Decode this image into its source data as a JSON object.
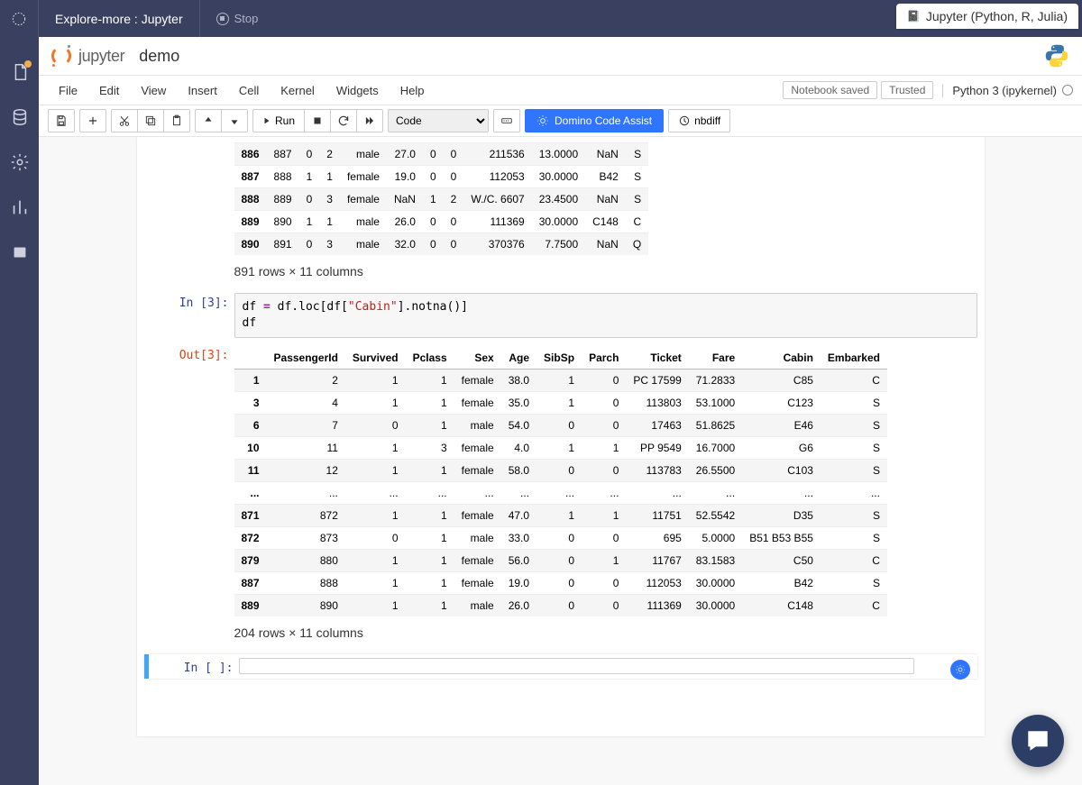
{
  "topbar": {
    "title": "Explore-more : Jupyter",
    "stop_label": "Stop",
    "chip_label": "Jupyter (Python, R, Julia)"
  },
  "header": {
    "logo_word": "jupyter",
    "notebook_name": "demo"
  },
  "menu": {
    "items": [
      "File",
      "Edit",
      "View",
      "Insert",
      "Cell",
      "Kernel",
      "Widgets",
      "Help"
    ],
    "status": "Notebook saved",
    "trusted": "Trusted",
    "kernel": "Python 3 (ipykernel)"
  },
  "toolbar": {
    "run_label": "Run",
    "cell_type": "Code",
    "dca_label": "Domino Code Assist",
    "nbdiff_label": "nbdiff"
  },
  "cells": {
    "in3_label": "In [3]:",
    "out3_label": "Out[3]:",
    "in3_code_plain": "df = df.loc[df[\"Cabin\"].notna()]\ndf",
    "in_empty_label": "In [ ]:"
  },
  "table1": {
    "rows": [
      {
        "idx": "886",
        "PassengerId": "887",
        "Survived": "0",
        "Pclass": "2",
        "Sex": "male",
        "Age": "27.0",
        "SibSp": "0",
        "Parch": "0",
        "Ticket": "211536",
        "Fare": "13.0000",
        "Cabin": "NaN",
        "Embarked": "S"
      },
      {
        "idx": "887",
        "PassengerId": "888",
        "Survived": "1",
        "Pclass": "1",
        "Sex": "female",
        "Age": "19.0",
        "SibSp": "0",
        "Parch": "0",
        "Ticket": "112053",
        "Fare": "30.0000",
        "Cabin": "B42",
        "Embarked": "S"
      },
      {
        "idx": "888",
        "PassengerId": "889",
        "Survived": "0",
        "Pclass": "3",
        "Sex": "female",
        "Age": "NaN",
        "SibSp": "1",
        "Parch": "2",
        "Ticket": "W./C. 6607",
        "Fare": "23.4500",
        "Cabin": "NaN",
        "Embarked": "S"
      },
      {
        "idx": "889",
        "PassengerId": "890",
        "Survived": "1",
        "Pclass": "1",
        "Sex": "male",
        "Age": "26.0",
        "SibSp": "0",
        "Parch": "0",
        "Ticket": "111369",
        "Fare": "30.0000",
        "Cabin": "C148",
        "Embarked": "C"
      },
      {
        "idx": "890",
        "PassengerId": "891",
        "Survived": "0",
        "Pclass": "3",
        "Sex": "male",
        "Age": "32.0",
        "SibSp": "0",
        "Parch": "0",
        "Ticket": "370376",
        "Fare": "7.7500",
        "Cabin": "NaN",
        "Embarked": "Q"
      }
    ],
    "summary": "891 rows × 11 columns"
  },
  "table2": {
    "headers": [
      "PassengerId",
      "Survived",
      "Pclass",
      "Sex",
      "Age",
      "SibSp",
      "Parch",
      "Ticket",
      "Fare",
      "Cabin",
      "Embarked"
    ],
    "rows": [
      {
        "idx": "1",
        "PassengerId": "2",
        "Survived": "1",
        "Pclass": "1",
        "Sex": "female",
        "Age": "38.0",
        "SibSp": "1",
        "Parch": "0",
        "Ticket": "PC 17599",
        "Fare": "71.2833",
        "Cabin": "C85",
        "Embarked": "C"
      },
      {
        "idx": "3",
        "PassengerId": "4",
        "Survived": "1",
        "Pclass": "1",
        "Sex": "female",
        "Age": "35.0",
        "SibSp": "1",
        "Parch": "0",
        "Ticket": "113803",
        "Fare": "53.1000",
        "Cabin": "C123",
        "Embarked": "S"
      },
      {
        "idx": "6",
        "PassengerId": "7",
        "Survived": "0",
        "Pclass": "1",
        "Sex": "male",
        "Age": "54.0",
        "SibSp": "0",
        "Parch": "0",
        "Ticket": "17463",
        "Fare": "51.8625",
        "Cabin": "E46",
        "Embarked": "S"
      },
      {
        "idx": "10",
        "PassengerId": "11",
        "Survived": "1",
        "Pclass": "3",
        "Sex": "female",
        "Age": "4.0",
        "SibSp": "1",
        "Parch": "1",
        "Ticket": "PP 9549",
        "Fare": "16.7000",
        "Cabin": "G6",
        "Embarked": "S"
      },
      {
        "idx": "11",
        "PassengerId": "12",
        "Survived": "1",
        "Pclass": "1",
        "Sex": "female",
        "Age": "58.0",
        "SibSp": "0",
        "Parch": "0",
        "Ticket": "113783",
        "Fare": "26.5500",
        "Cabin": "C103",
        "Embarked": "S"
      },
      {
        "idx": "...",
        "PassengerId": "...",
        "Survived": "...",
        "Pclass": "...",
        "Sex": "...",
        "Age": "...",
        "SibSp": "...",
        "Parch": "...",
        "Ticket": "...",
        "Fare": "...",
        "Cabin": "...",
        "Embarked": "..."
      },
      {
        "idx": "871",
        "PassengerId": "872",
        "Survived": "1",
        "Pclass": "1",
        "Sex": "female",
        "Age": "47.0",
        "SibSp": "1",
        "Parch": "1",
        "Ticket": "11751",
        "Fare": "52.5542",
        "Cabin": "D35",
        "Embarked": "S"
      },
      {
        "idx": "872",
        "PassengerId": "873",
        "Survived": "0",
        "Pclass": "1",
        "Sex": "male",
        "Age": "33.0",
        "SibSp": "0",
        "Parch": "0",
        "Ticket": "695",
        "Fare": "5.0000",
        "Cabin": "B51 B53 B55",
        "Embarked": "S"
      },
      {
        "idx": "879",
        "PassengerId": "880",
        "Survived": "1",
        "Pclass": "1",
        "Sex": "female",
        "Age": "56.0",
        "SibSp": "0",
        "Parch": "1",
        "Ticket": "11767",
        "Fare": "83.1583",
        "Cabin": "C50",
        "Embarked": "C"
      },
      {
        "idx": "887",
        "PassengerId": "888",
        "Survived": "1",
        "Pclass": "1",
        "Sex": "female",
        "Age": "19.0",
        "SibSp": "0",
        "Parch": "0",
        "Ticket": "112053",
        "Fare": "30.0000",
        "Cabin": "B42",
        "Embarked": "S"
      },
      {
        "idx": "889",
        "PassengerId": "890",
        "Survived": "1",
        "Pclass": "1",
        "Sex": "male",
        "Age": "26.0",
        "SibSp": "0",
        "Parch": "0",
        "Ticket": "111369",
        "Fare": "30.0000",
        "Cabin": "C148",
        "Embarked": "C"
      }
    ],
    "summary": "204 rows × 11 columns"
  }
}
